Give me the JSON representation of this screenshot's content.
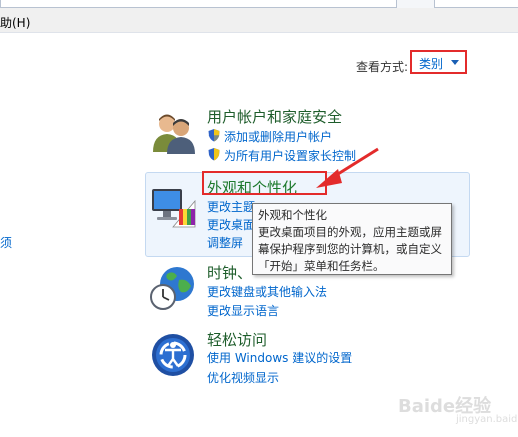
{
  "menubar": {
    "help_label": "助(H)"
  },
  "view_by": {
    "label": "查看方式:",
    "value": "类别"
  },
  "left_partial_text": "须",
  "categories": [
    {
      "title": "用户帐户和家庭安全",
      "icon": "users-icon",
      "links": [
        "添加或删除用户帐户",
        "为所有用户设置家长控制"
      ]
    },
    {
      "title": "外观和个性化",
      "icon": "monitor-palette-icon",
      "links": [
        "更改主题",
        "更改桌面",
        "调整屏"
      ]
    },
    {
      "title": "时钟、",
      "icon": "globe-clock-icon",
      "links": [
        "更改键盘或其他输入法",
        "更改显示语言"
      ]
    },
    {
      "title": "轻松访问",
      "icon": "ease-of-access-icon",
      "links": [
        "使用 Windows 建议的设置",
        "优化视频显示"
      ]
    }
  ],
  "tooltip": {
    "lines": [
      "外观和个性化",
      "更改桌面项目的外观，应用主题或屏",
      "幕保护程序到您的计算机，或自定义",
      "「开始」菜单和任务栏。"
    ]
  },
  "annotation_color": "#e32b2b",
  "watermark": {
    "text": "Baide经验",
    "sub": "jingyan.baidu.com"
  }
}
